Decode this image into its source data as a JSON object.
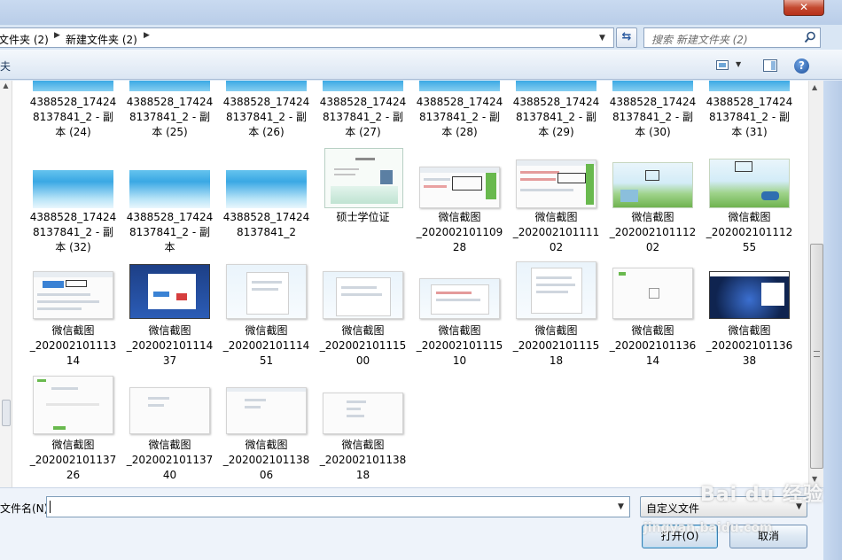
{
  "window": {
    "close_symbol": "✕"
  },
  "address_bar": {
    "crumbs": [
      "文件夹 (2)",
      "新建文件夹 (2)"
    ],
    "separator": "▶"
  },
  "search": {
    "placeholder": "搜索 新建文件夹 (2)"
  },
  "toolbar": {
    "left_fragment": "夫",
    "help": "?"
  },
  "files": [
    {
      "lines": [
        "4388528_17424",
        "8137841_2 - 副",
        "本 (24)"
      ]
    },
    {
      "lines": [
        "4388528_17424",
        "8137841_2 - 副",
        "本 (25)"
      ]
    },
    {
      "lines": [
        "4388528_17424",
        "8137841_2 - 副",
        "本 (26)"
      ]
    },
    {
      "lines": [
        "4388528_17424",
        "8137841_2 - 副",
        "本 (27)"
      ]
    },
    {
      "lines": [
        "4388528_17424",
        "8137841_2 - 副",
        "本 (28)"
      ]
    },
    {
      "lines": [
        "4388528_17424",
        "8137841_2 - 副",
        "本 (29)"
      ]
    },
    {
      "lines": [
        "4388528_17424",
        "8137841_2 - 副",
        "本 (30)"
      ]
    },
    {
      "lines": [
        "4388528_17424",
        "8137841_2 - 副",
        "本 (31)"
      ]
    },
    {
      "lines": [
        "4388528_17424",
        "8137841_2 - 副",
        "本 (32)"
      ]
    },
    {
      "lines": [
        "4388528_17424",
        "8137841_2 - 副",
        "本"
      ]
    },
    {
      "lines": [
        "4388528_17424",
        "8137841_2"
      ]
    },
    {
      "lines": [
        "硕士学位证"
      ]
    },
    {
      "lines": [
        "微信截图",
        "_202002101109",
        "28"
      ]
    },
    {
      "lines": [
        "微信截图",
        "_202002101111",
        "02"
      ]
    },
    {
      "lines": [
        "微信截图",
        "_202002101112",
        "02"
      ]
    },
    {
      "lines": [
        "微信截图",
        "_202002101112",
        "55"
      ]
    },
    {
      "lines": [
        "微信截图",
        "_202002101113",
        "14"
      ]
    },
    {
      "lines": [
        "微信截图",
        "_202002101114",
        "37"
      ]
    },
    {
      "lines": [
        "微信截图",
        "_202002101114",
        "51"
      ]
    },
    {
      "lines": [
        "微信截图",
        "_202002101115",
        "00"
      ]
    },
    {
      "lines": [
        "微信截图",
        "_202002101115",
        "10"
      ]
    },
    {
      "lines": [
        "微信截图",
        "_202002101115",
        "18"
      ]
    },
    {
      "lines": [
        "微信截图",
        "_202002101136",
        "14"
      ]
    },
    {
      "lines": [
        "微信截图",
        "_202002101136",
        "38"
      ]
    },
    {
      "lines": [
        "微信截图",
        "_202002101137",
        "26"
      ]
    },
    {
      "lines": [
        "微信截图",
        "_202002101137",
        "40"
      ]
    },
    {
      "lines": [
        "微信截图",
        "_202002101138",
        "06"
      ]
    },
    {
      "lines": [
        "微信截图",
        "_202002101138",
        "18"
      ]
    }
  ],
  "bottom": {
    "filename_label": "文件名(N):",
    "filename_value": "",
    "filetype": "自定义文件",
    "open_button": "打开(O)",
    "cancel_button": "取消"
  },
  "watermark": {
    "brand": "Bai du 经验",
    "url": "jingyan.baidu.com"
  },
  "colors": {
    "window_frame": "#c9daf0",
    "close_button": "#c44a31",
    "pane_bg": "#ffffff",
    "thumbnail_blue": "#3aa8e4"
  }
}
